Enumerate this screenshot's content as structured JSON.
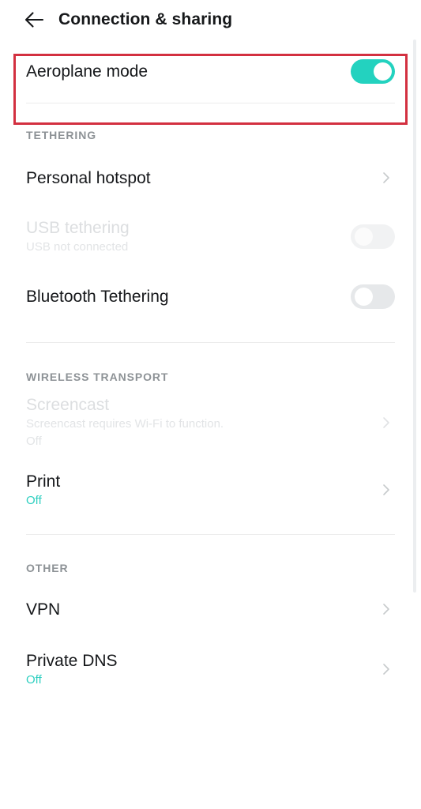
{
  "header": {
    "title": "Connection & sharing",
    "back_icon": "arrow-left-icon"
  },
  "annotation": {
    "highlight_color": "#d33040",
    "target": "Aeroplane mode"
  },
  "theme": {
    "accent": "#2ecfc0",
    "toggle_on": "#23d2bf",
    "toggle_off_track": "#e6e8ea",
    "title_color": "#15171a",
    "subtitle_color": "#9aa0a6",
    "disabled_color": "#dcdee0",
    "section_label_color": "#8d9296",
    "divider_color": "#ececec",
    "background": "#ffffff"
  },
  "rows": {
    "aeroplane_mode": {
      "title": "Aeroplane mode",
      "toggle_state": "on",
      "toggle_label": "On"
    },
    "personal_hotspot": {
      "title": "Personal hotspot",
      "chevron_icon": "chevron-right-icon"
    },
    "usb_tethering": {
      "title": "USB tethering",
      "subtitle": "USB not connected",
      "toggle_state": "off",
      "disabled": true
    },
    "bluetooth_tethering": {
      "title": "Bluetooth Tethering",
      "toggle_state": "off",
      "disabled": false
    },
    "screencast": {
      "title": "Screencast",
      "subtitle": "Screencast requires Wi-Fi to function.",
      "status": "Off",
      "disabled": true,
      "chevron_icon": "chevron-right-icon"
    },
    "print": {
      "title": "Print",
      "status": "Off",
      "chevron_icon": "chevron-right-icon"
    },
    "vpn": {
      "title": "VPN",
      "chevron_icon": "chevron-right-icon"
    },
    "private_dns": {
      "title": "Private DNS",
      "status": "Off",
      "chevron_icon": "chevron-right-icon"
    }
  },
  "sections": {
    "tethering": "TETHERING",
    "wireless_transport": "WIRELESS TRANSPORT",
    "other": "OTHER"
  }
}
